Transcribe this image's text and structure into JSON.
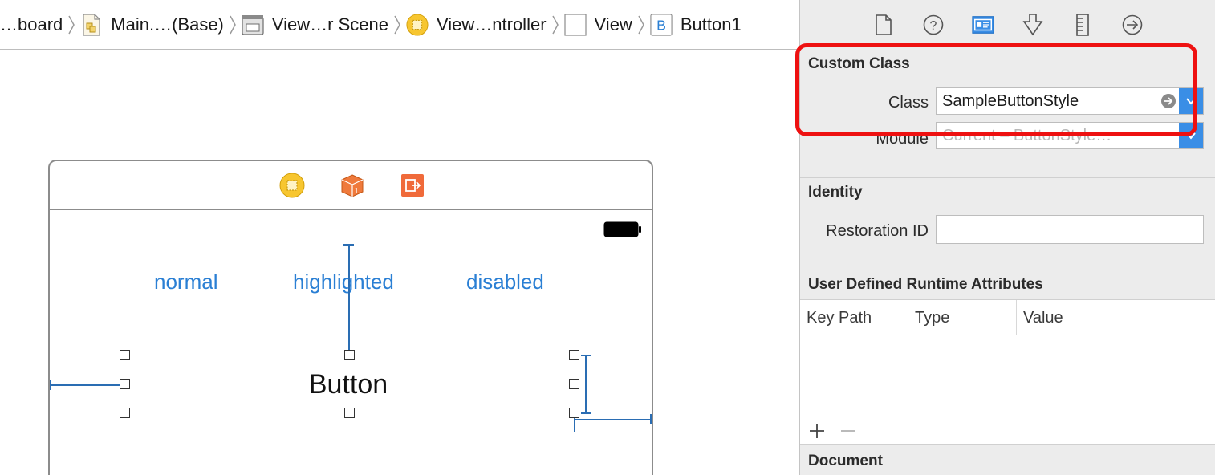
{
  "breadcrumb": {
    "items": [
      {
        "label": "…board",
        "icon": "none"
      },
      {
        "label": "Main.…(Base)",
        "icon": "storyboard-file-icon"
      },
      {
        "label": "View…r Scene",
        "icon": "scene-icon"
      },
      {
        "label": "View…ntroller",
        "icon": "view-controller-icon"
      },
      {
        "label": "View",
        "icon": "view-icon"
      },
      {
        "label": "Button1",
        "icon": "button-icon"
      }
    ]
  },
  "scene": {
    "dock": [
      "view-controller-icon",
      "first-responder-icon",
      "exit-icon"
    ],
    "labels": {
      "normal": "normal",
      "highlighted": "highlighted",
      "disabled": "disabled"
    },
    "button_title": "Button"
  },
  "inspector": {
    "tabs": [
      "file-inspector-icon",
      "quick-help-icon",
      "identity-inspector-icon",
      "attributes-inspector-icon",
      "size-inspector-icon",
      "connections-inspector-icon"
    ],
    "custom_class": {
      "title": "Custom Class",
      "class_label": "Class",
      "class_value": "SampleButtonStyle",
      "module_label": "Module",
      "module_placeholder": "Current – ButtonStyle…"
    },
    "identity": {
      "title": "Identity",
      "restoration_label": "Restoration ID",
      "restoration_value": ""
    },
    "runtime_attributes": {
      "title": "User Defined Runtime Attributes",
      "columns": [
        "Key Path",
        "Type",
        "Value"
      ]
    },
    "document": {
      "title": "Document"
    }
  },
  "colors": {
    "accent": "#3a8ee6",
    "label_blue": "#2a7fd4",
    "highlight_red": "#ee1111"
  }
}
